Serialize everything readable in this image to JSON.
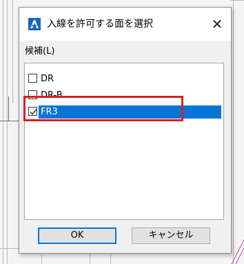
{
  "dialog": {
    "title": "入線を許可する面を選択",
    "close_glyph": "✕",
    "candidates_label": "候補(L)",
    "items": [
      {
        "label": "DR",
        "checked": false,
        "selected": false
      },
      {
        "label": "DR-B",
        "checked": false,
        "selected": false
      },
      {
        "label": "FR3",
        "checked": true,
        "selected": true
      }
    ],
    "ok_label": "OK",
    "cancel_label": "キャンセル"
  },
  "colors": {
    "selection": "#0a74d6",
    "annotation_box": "#e01b22",
    "app_icon": "#1565c0"
  }
}
